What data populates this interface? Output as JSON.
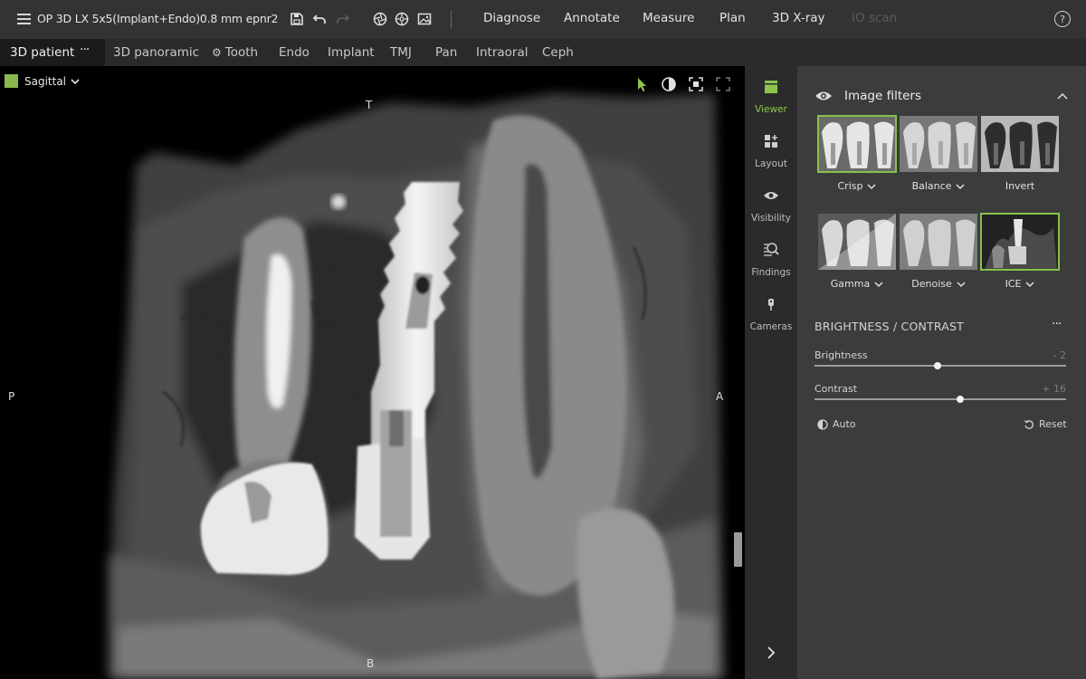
{
  "app": {
    "title": "OP 3D LX 5x5(Implant+Endo)0.8 mm epnr2",
    "main_tabs": [
      {
        "label": "Diagnose",
        "enabled": true
      },
      {
        "label": "Annotate",
        "enabled": true
      },
      {
        "label": "Measure",
        "enabled": true
      },
      {
        "label": "Plan",
        "enabled": true
      },
      {
        "label": "3D X-ray",
        "enabled": true
      },
      {
        "label": "IO scan",
        "enabled": false
      }
    ],
    "help_label": "?",
    "toolbar_icons": [
      "save-icon",
      "undo-icon",
      "redo-icon",
      "aperture-icon",
      "crosshair-icon",
      "image-icon"
    ]
  },
  "tabbar": {
    "active_label": "3D patient",
    "more_label": "···",
    "tabs": [
      "3D panoramic",
      "Tooth",
      "Endo",
      "Implant",
      "TMJ",
      "Pan",
      "Intraoral",
      "Ceph"
    ]
  },
  "viewer": {
    "view_name": "Sagittal",
    "view_color": "#8ab84f",
    "orient": {
      "top": "T",
      "bottom": "B",
      "left": "P",
      "right": "A"
    },
    "scroll_position": 0.68
  },
  "sidenav": [
    {
      "label": "Viewer",
      "icon": "viewer-icon",
      "active": true
    },
    {
      "label": "Layout",
      "icon": "layout-icon",
      "active": false
    },
    {
      "label": "Visibility",
      "icon": "visibility-icon",
      "active": false
    },
    {
      "label": "Findings",
      "icon": "findings-icon",
      "active": false
    },
    {
      "label": "Cameras",
      "icon": "cameras-icon",
      "active": false
    }
  ],
  "panel": {
    "filters_title": "Image filters",
    "filters": [
      {
        "label": "Crisp",
        "dropdown": true,
        "selected": true
      },
      {
        "label": "Balance",
        "dropdown": true,
        "selected": false
      },
      {
        "label": "Invert",
        "dropdown": false,
        "selected": false
      },
      {
        "label": "Gamma",
        "dropdown": true,
        "selected": false
      },
      {
        "label": "Denoise",
        "dropdown": true,
        "selected": false
      },
      {
        "label": "ICE",
        "dropdown": true,
        "selected": true
      }
    ],
    "bc_title": "BRIGHTNESS / CONTRAST",
    "bc_more": "···",
    "brightness": {
      "label": "Brightness",
      "value_text": "- 2",
      "position": 0.49
    },
    "contrast": {
      "label": "Contrast",
      "value_text": "+ 16",
      "position": 0.58
    },
    "auto_label": "Auto",
    "reset_label": "Reset",
    "accent": "#86c24a"
  }
}
